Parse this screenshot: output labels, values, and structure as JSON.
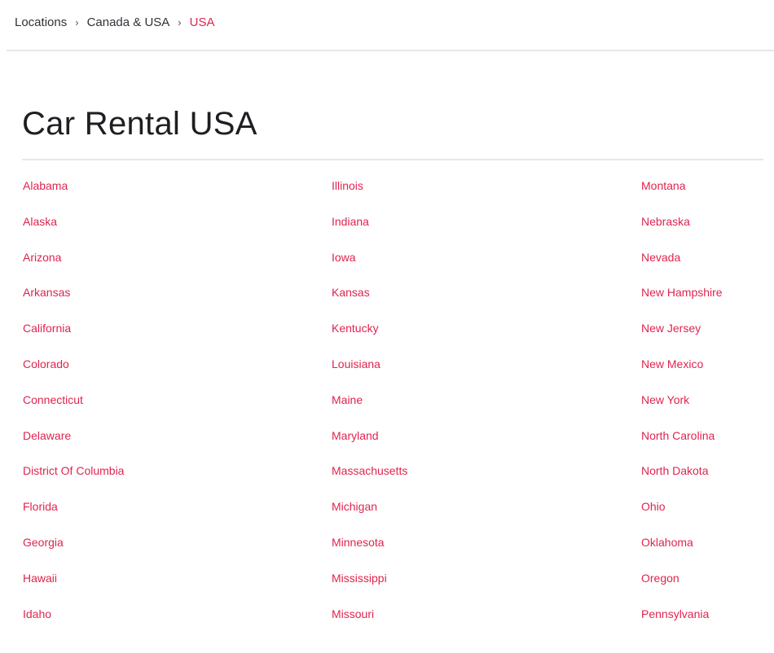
{
  "breadcrumb": {
    "items": [
      "Locations",
      "Canada & USA"
    ],
    "separator": "›",
    "current": "USA"
  },
  "colors": {
    "accent": "#e0244f",
    "text": "#1d1f22",
    "divider": "#e7e7e7"
  },
  "page": {
    "title": "Car Rental USA"
  },
  "states": {
    "columns": [
      [
        "Alabama",
        "Alaska",
        "Arizona",
        "Arkansas",
        "California",
        "Colorado",
        "Connecticut",
        "Delaware",
        "District Of Columbia",
        "Florida",
        "Georgia",
        "Hawaii",
        "Idaho"
      ],
      [
        "Illinois",
        "Indiana",
        "Iowa",
        "Kansas",
        "Kentucky",
        "Louisiana",
        "Maine",
        "Maryland",
        "Massachusetts",
        "Michigan",
        "Minnesota",
        "Mississippi",
        "Missouri"
      ],
      [
        "Montana",
        "Nebraska",
        "Nevada",
        "New Hampshire",
        "New Jersey",
        "New Mexico",
        "New York",
        "North Carolina",
        "North Dakota",
        "Ohio",
        "Oklahoma",
        "Oregon",
        "Pennsylvania"
      ]
    ]
  }
}
